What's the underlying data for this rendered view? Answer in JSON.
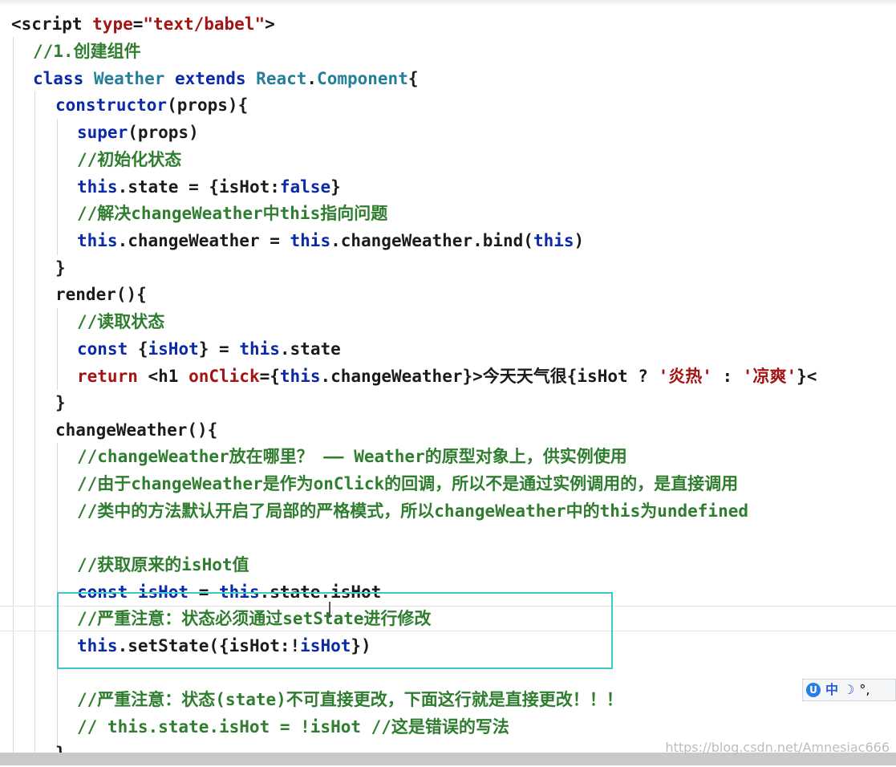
{
  "editor": {
    "lines": [
      "<script type=\"text/babel\">",
      "//1.创建组件",
      "class Weather extends React.Component{",
      "constructor(props){",
      "super(props)",
      "//初始化状态",
      "this.state = {isHot:false}",
      "//解决changeWeather中this指向问题",
      "this.changeWeather = this.changeWeather.bind(this)",
      "}",
      "render(){",
      "//读取状态",
      "const {isHot} = this.state",
      "return <h1 onClick={this.changeWeather}>今天天气很{isHot ? '炎热' : '凉爽'}<",
      "}",
      "changeWeather(){",
      "//changeWeather放在哪里？ —— Weather的原型对象上，供实例使用",
      "//由于changeWeather是作为onClick的回调，所以不是通过实例调用的，是直接调用",
      "//类中的方法默认开启了局部的严格模式，所以changeWeather中的this为undefined",
      "",
      "//获取原来的isHot值",
      "const isHot = this.state.isHot",
      "//严重注意：状态必须通过setState进行修改",
      "this.setState({isHot:!isHot})",
      "",
      "//严重注意：状态(state)不可直接更改，下面这行就是直接更改！！！",
      "// this.state.isHot = !isHot //这是错误的写法",
      "}"
    ]
  },
  "ime": {
    "label": "中",
    "moon": "☽",
    "punct": "°,"
  },
  "watermark": "https://blog.csdn.net/Amnesiac666"
}
